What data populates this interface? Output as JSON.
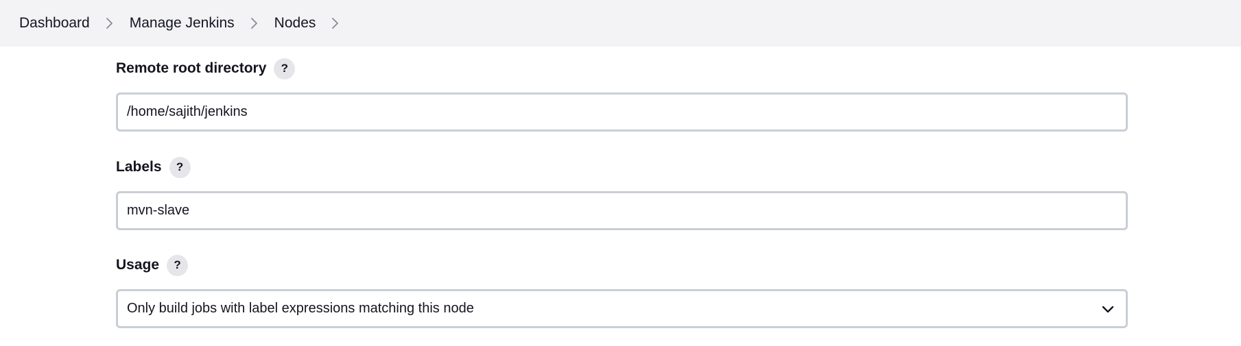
{
  "breadcrumb": {
    "items": [
      {
        "label": "Dashboard"
      },
      {
        "label": "Manage Jenkins"
      },
      {
        "label": "Nodes"
      }
    ]
  },
  "form": {
    "remote_root": {
      "label": "Remote root directory",
      "help": "?",
      "value": "/home/sajith/jenkins"
    },
    "labels": {
      "label": "Labels",
      "help": "?",
      "value": "mvn-slave"
    },
    "usage": {
      "label": "Usage",
      "help": "?",
      "selected": "Only build jobs with label expressions matching this node"
    }
  },
  "icons": {
    "breadcrumb_separator": "chevron-right-icon",
    "select_caret": "chevron-down-icon"
  },
  "colors": {
    "breadcrumb_bg": "#f3f3f6",
    "input_border": "#c9ced6",
    "help_bg": "#e5e5ea",
    "text": "#14141f"
  }
}
